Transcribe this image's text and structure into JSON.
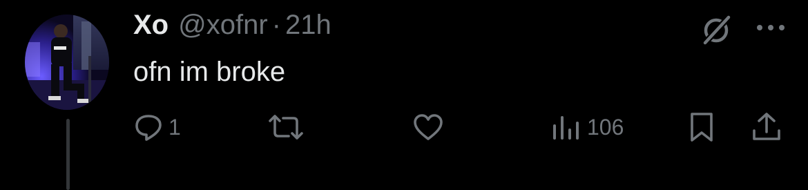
{
  "post": {
    "author": {
      "name": "Xo",
      "handle": "@xofnr",
      "separator": "·",
      "time": "21h",
      "avatar_icon": "avatar-photo"
    },
    "text": "ofn im broke",
    "header_icons": [
      "grok-icon",
      "more-icon"
    ],
    "actions": {
      "reply": {
        "icon": "reply-icon",
        "count": "1"
      },
      "repost": {
        "icon": "repost-icon",
        "count": ""
      },
      "like": {
        "icon": "like-icon",
        "count": ""
      },
      "views": {
        "icon": "views-icon",
        "count": "106"
      },
      "bookmark": {
        "icon": "bookmark-icon"
      },
      "share": {
        "icon": "share-icon"
      }
    }
  },
  "colors": {
    "background": "#000000",
    "primary_text": "#e7e9ea",
    "secondary_text": "#71767b",
    "thread_line": "#333639"
  }
}
